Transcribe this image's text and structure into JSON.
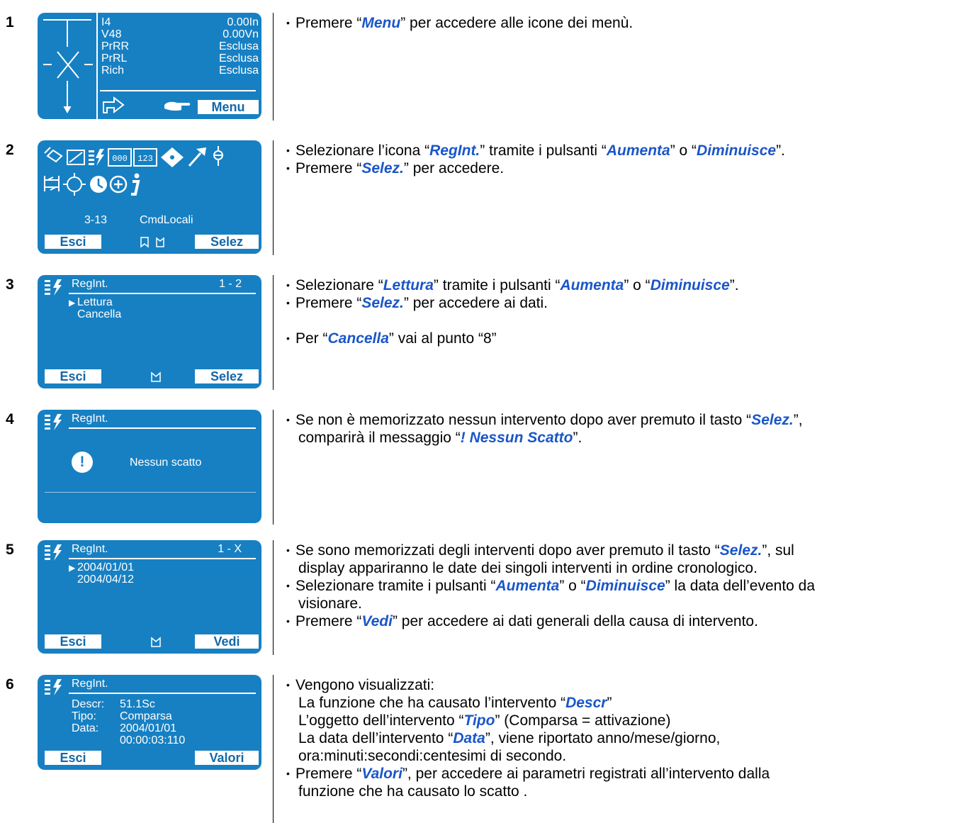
{
  "steps": [
    {
      "number": "1",
      "screen": {
        "rows": [
          {
            "label": "I4",
            "value": "0.00In"
          },
          {
            "label": "V48",
            "value": "0.00Vn"
          },
          {
            "label": "PrRR",
            "value": "Esclusa"
          },
          {
            "label": "PrRL",
            "value": "Esclusa"
          },
          {
            "label": "Rich",
            "value": "Esclusa"
          }
        ],
        "button": "Menu"
      },
      "desc": {
        "a": "Premere “",
        "k": "Menu",
        "b": "” per accedere alle icone dei menù."
      }
    },
    {
      "number": "2",
      "screen": {
        "code": "3-13",
        "label": "CmdLocali",
        "btn_left": "Esci",
        "btn_right": "Selez",
        "icon_a": "000",
        "icon_b": "123"
      },
      "desc": [
        {
          "a": "Selezionare l’icona “",
          "k1": "RegInt.",
          "b": "” tramite i pulsanti “",
          "k2": "Aumenta",
          "c": "” o “",
          "k3": "Diminuisce",
          "d": "”."
        },
        {
          "a": "Premere “",
          "k": "Selez.",
          "b": "” per accedere."
        }
      ]
    },
    {
      "number": "3",
      "screen": {
        "title": "RegInt.",
        "page": "1 - 2",
        "item1": "Lettura",
        "item2": "Cancella",
        "btn_left": "Esci",
        "btn_right": "Selez"
      },
      "desc": [
        {
          "a": "Selezionare “",
          "k1": "Lettura",
          "b": "” tramite i pulsanti “",
          "k2": "Aumenta",
          "c": "” o “",
          "k3": "Diminuisce",
          "d": "”."
        },
        {
          "a": "Premere “",
          "k": "Selez.",
          "b": "” per accedere ai dati."
        },
        {
          "a": "Per “",
          "k": "Cancella",
          "b": "” vai al punto “8”"
        }
      ]
    },
    {
      "number": "4",
      "screen": {
        "title": "RegInt.",
        "message": "Nessun scatto",
        "mark": "!"
      },
      "desc": {
        "a": "Se non è memorizzato nessun intervento dopo aver premuto il tasto “",
        "k1": "Selez.",
        "b": "”,",
        "c": "comparirà il messaggio “",
        "k2": "! Nessun Scatto",
        "d": "”."
      }
    },
    {
      "number": "5",
      "screen": {
        "title": "RegInt.",
        "page": "1 - X",
        "item1": "2004/01/01",
        "item2": "2004/04/12",
        "btn_left": "Esci",
        "btn_right": "Vedi"
      },
      "desc": [
        {
          "a": "Se sono memorizzati degli interventi dopo aver premuto il tasto “",
          "k": "Selez.",
          "b": "”, sul",
          "c": "display appariranno le date dei singoli interventi in ordine cronologico."
        },
        {
          "a": "Selezionare tramite i pulsanti “",
          "k1": "Aumenta",
          "b": "” o “",
          "k2": "Diminuisce",
          "c": "” la data dell’evento da",
          "d": "visionare."
        },
        {
          "a": "Premere “",
          "k": "Vedi",
          "b": "” per accedere ai dati generali della causa di intervento."
        }
      ]
    },
    {
      "number": "6",
      "screen": {
        "title": "RegInt.",
        "descr_label": "Descr:",
        "descr": "51.1Sc",
        "tipo_label": "Tipo:",
        "tipo": "Comparsa",
        "data_label": "Data:",
        "data": "2004/01/01",
        "time": "00:00:03:110",
        "btn_left": "Esci",
        "btn_right": "Valori"
      },
      "desc": {
        "intro": "Vengono visualizzati:",
        "l1a": "La funzione che ha causato l’intervento “",
        "l1k": "Descr",
        "l1b": "”",
        "l2a": "L’oggetto dell’intervento “",
        "l2k": "Tipo",
        "l2b": "” (Comparsa = attivazione)",
        "l3a": "La data dell’intervento “",
        "l3k": "Data",
        "l3b": "”, viene riportato anno/mese/giorno,",
        "l4": "ora:minuti:secondi:centesimi di secondo.",
        "l5a": "Premere “",
        "l5k": "Valori",
        "l5b": "”, per accedere ai parametri registrati all’intervento dalla",
        "l6": "funzione che ha causato lo scatto ."
      }
    }
  ]
}
